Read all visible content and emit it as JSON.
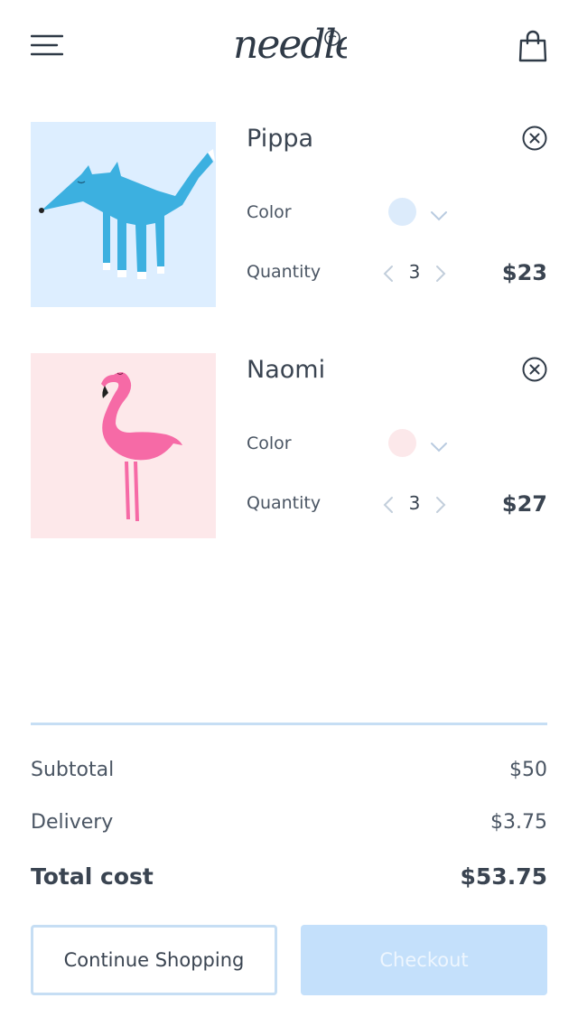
{
  "header": {
    "logo_text": "needle",
    "menu_icon": "hamburger-menu-icon",
    "cart_icon": "shopping-bag-icon"
  },
  "cart": {
    "items": [
      {
        "name": "Pippa",
        "color_label": "Color",
        "color_value": "#dcebfb",
        "quantity_label": "Quantity",
        "quantity": "3",
        "price": "$23",
        "image_bg": "#ddeeff"
      },
      {
        "name": "Naomi",
        "color_label": "Color",
        "color_value": "#fce8ea",
        "quantity_label": "Quantity",
        "quantity": "3",
        "price": "$27",
        "image_bg": "#fde8ea"
      }
    ]
  },
  "summary": {
    "subtotal_label": "Subtotal",
    "subtotal_value": "$50",
    "delivery_label": "Delivery",
    "delivery_value": "$3.75",
    "total_label": "Total cost",
    "total_value": "$53.75"
  },
  "actions": {
    "continue_label": "Continue Shopping",
    "checkout_label": "Checkout"
  },
  "colors": {
    "accent_light": "#c4e0fb",
    "divider": "#c6def4",
    "text": "#3a4451"
  }
}
